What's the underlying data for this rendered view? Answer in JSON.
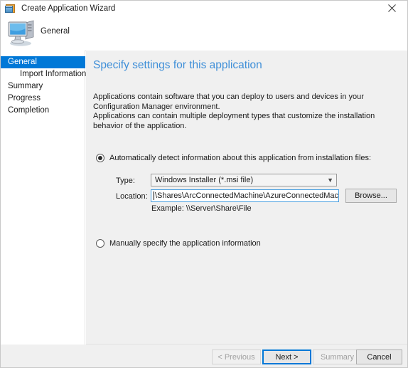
{
  "window": {
    "title": "Create Application Wizard",
    "title_icon": "application-wizard-icon",
    "close_icon": "close-icon"
  },
  "header": {
    "icon": "computer-icon",
    "title": "General"
  },
  "sidebar": {
    "items": [
      {
        "label": "General",
        "selected": true,
        "indented": false
      },
      {
        "label": "Import Information",
        "selected": false,
        "indented": true
      },
      {
        "label": "Summary",
        "selected": false,
        "indented": false
      },
      {
        "label": "Progress",
        "selected": false,
        "indented": false
      },
      {
        "label": "Completion",
        "selected": false,
        "indented": false
      }
    ]
  },
  "content": {
    "heading": "Specify settings for this application",
    "description_line1": "Applications contain software that you can deploy to users and devices in your Configuration Manager environment.",
    "description_line2": "Applications can contain multiple deployment types that customize the installation behavior of the application.",
    "radio_auto_label": "Automatically detect information about this application from installation files:",
    "radio_manual_label": "Manually specify the application information",
    "type_label": "Type:",
    "type_value": "Windows Installer (*.msi file)",
    "type_chevron": "chevron-down-icon",
    "location_label": "Location:",
    "location_value": "\\Shares\\ArcConnectedMachine\\AzureConnectedMachineAgent.msi",
    "browse_label": "Browse...",
    "example_hint": "Example: \\\\Server\\Share\\File"
  },
  "footer": {
    "previous_label": "< Previous",
    "next_label": "Next >",
    "summary_label": "Summary",
    "cancel_label": "Cancel"
  },
  "colors": {
    "accent": "#0078d7",
    "heading": "#3f8fd8",
    "panel": "#f0f0f0",
    "focus_border": "#4a9fe0"
  }
}
